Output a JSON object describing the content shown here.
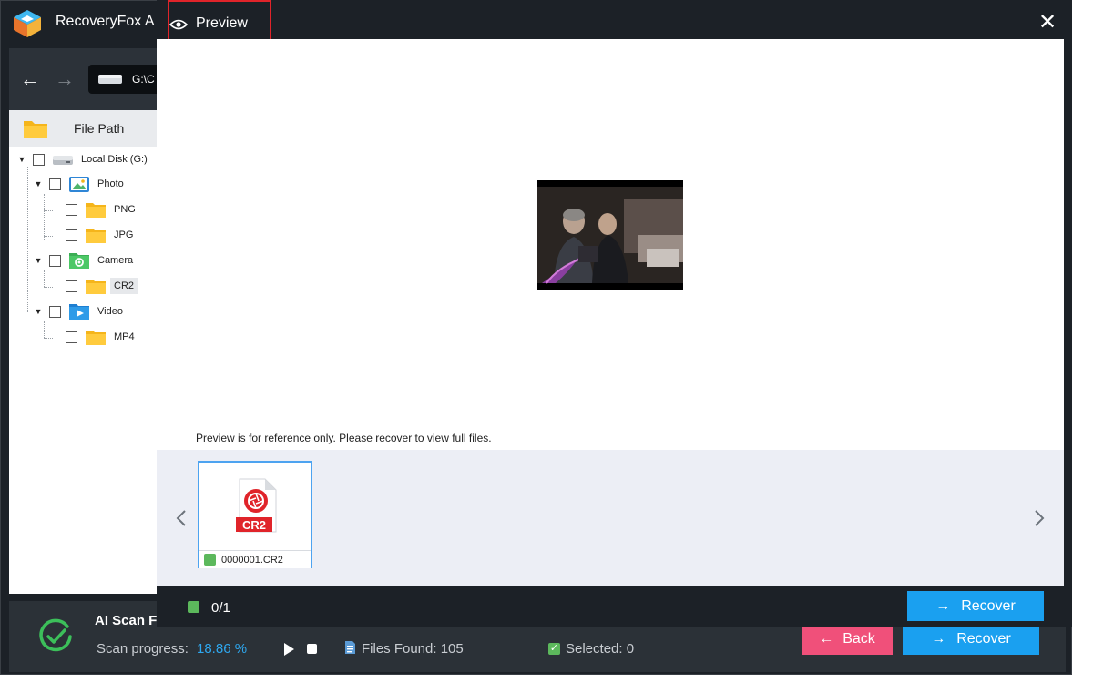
{
  "app": {
    "title": "RecoveryFox A",
    "path_text": "G:\\C",
    "tree_header_label": "File Path",
    "tree": [
      {
        "label": "Local Disk (G:)",
        "icon": "drive-icon"
      },
      {
        "label": "Photo",
        "icon": "photo-folder-icon"
      },
      {
        "label": "PNG",
        "icon": "folder-icon"
      },
      {
        "label": "JPG",
        "icon": "folder-icon"
      },
      {
        "label": "Camera",
        "icon": "camera-folder-icon"
      },
      {
        "label": "CR2",
        "icon": "folder-icon",
        "selected": true
      },
      {
        "label": "Video",
        "icon": "video-folder-icon"
      },
      {
        "label": "MP4",
        "icon": "folder-icon"
      }
    ]
  },
  "status": {
    "scan_title": "AI Scan F",
    "progress_label": "Scan progress:",
    "progress_value": "18.86 %",
    "progress_percent": 18.86,
    "files_found": "Files Found: 105",
    "selected": "Selected:  0",
    "back_label": "Back",
    "recover_label": "Recover"
  },
  "dialog": {
    "title": "Preview",
    "note": "Preview is for reference only. Please recover to view full files.",
    "thumbnail_filename": "0000001.CR2",
    "thumbnail_badge": "CR2",
    "count": "0/1",
    "recover_label": "Recover"
  },
  "colors": {
    "accent_blue": "#1aa0f0",
    "back_pink": "#f0507a",
    "highlight_red": "#e0242a",
    "success_green": "#5cb85c"
  }
}
